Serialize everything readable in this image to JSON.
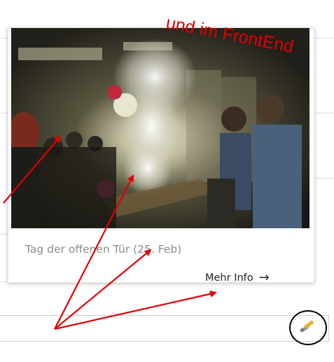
{
  "annotation": {
    "text": "und im FrontEnd",
    "color": "#e00000"
  },
  "card": {
    "image_alt": "Experiment at open day",
    "caption": "Tag der offenen Tür (25. Feb)",
    "more_label": "Mehr Info",
    "more_arrow": "→"
  },
  "icons": {
    "edit": "pencil-edit-icon",
    "arrow": "arrow-right-icon"
  }
}
